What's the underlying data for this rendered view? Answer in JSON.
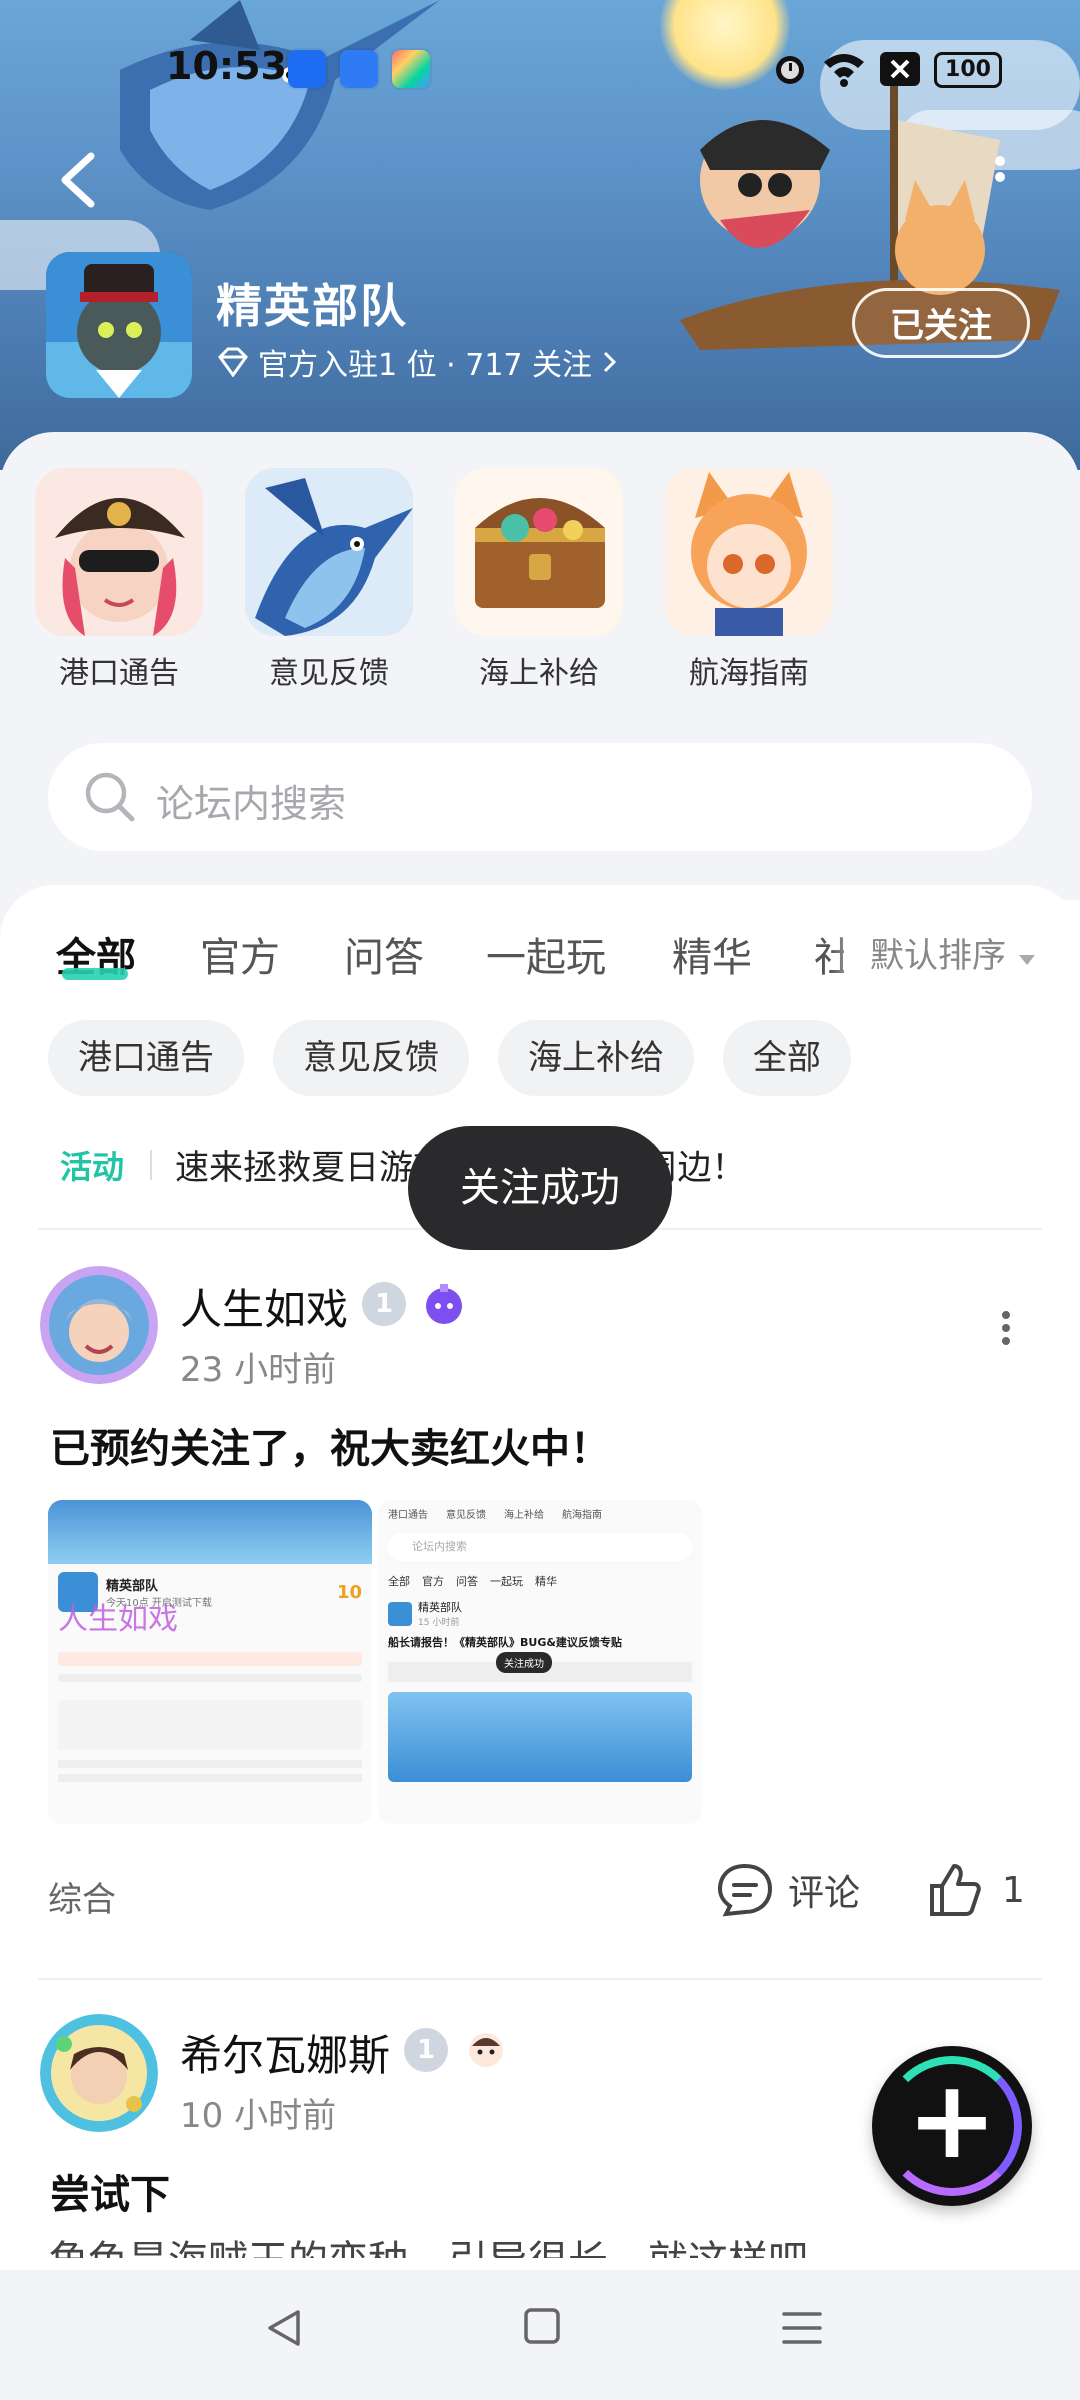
{
  "status_bar": {
    "time": "10:53",
    "battery": "100"
  },
  "header": {
    "forum_name": "精英部队",
    "meta": "官方入驻1 位 · 717 关注",
    "follow_label": "已关注"
  },
  "shortcuts": [
    {
      "label": "港口通告"
    },
    {
      "label": "意见反馈"
    },
    {
      "label": "海上补给"
    },
    {
      "label": "航海指南"
    }
  ],
  "search": {
    "placeholder": "论坛内搜索"
  },
  "tabs": [
    "全部",
    "官方",
    "问答",
    "一起玩",
    "精华",
    "社"
  ],
  "sort_label": "默认排序",
  "chips": [
    "港口通告",
    "意见反馈",
    "海上补给",
    "全部"
  ],
  "activity": {
    "tag": "活动",
    "text": "速来拯救夏日游戏，赢取新品&周边！"
  },
  "toast": "关注成功",
  "posts": [
    {
      "author": "人生如戏",
      "level": "1",
      "time": "23 小时前",
      "title": "已预约关注了，祝大卖红火中！",
      "category": "综合",
      "comment_label": "评论",
      "like_count": "1",
      "thumbnail_texts": {
        "forum": "精英部队",
        "subtitle": "今天10点 开启测试下载",
        "count": "10",
        "watermark": "人生如戏",
        "tabs": [
          "港口通告",
          "意见反馈",
          "海上补给",
          "航海指南"
        ],
        "search": "论坛内搜索",
        "subtabs": [
          "全部",
          "官方",
          "问答",
          "一起玩",
          "精华"
        ],
        "post_author": "精英部队",
        "post_time": "15 小时前",
        "post_title": "船长请报告！《精英部队》BUG&建议反馈专贴",
        "toast": "关注成功"
      }
    },
    {
      "author": "希尔瓦娜斯",
      "level": "1",
      "time": "10 小时前",
      "title": "尝试下",
      "preview": "角色是海贼王的变种，引导很长，就这样吧"
    }
  ]
}
